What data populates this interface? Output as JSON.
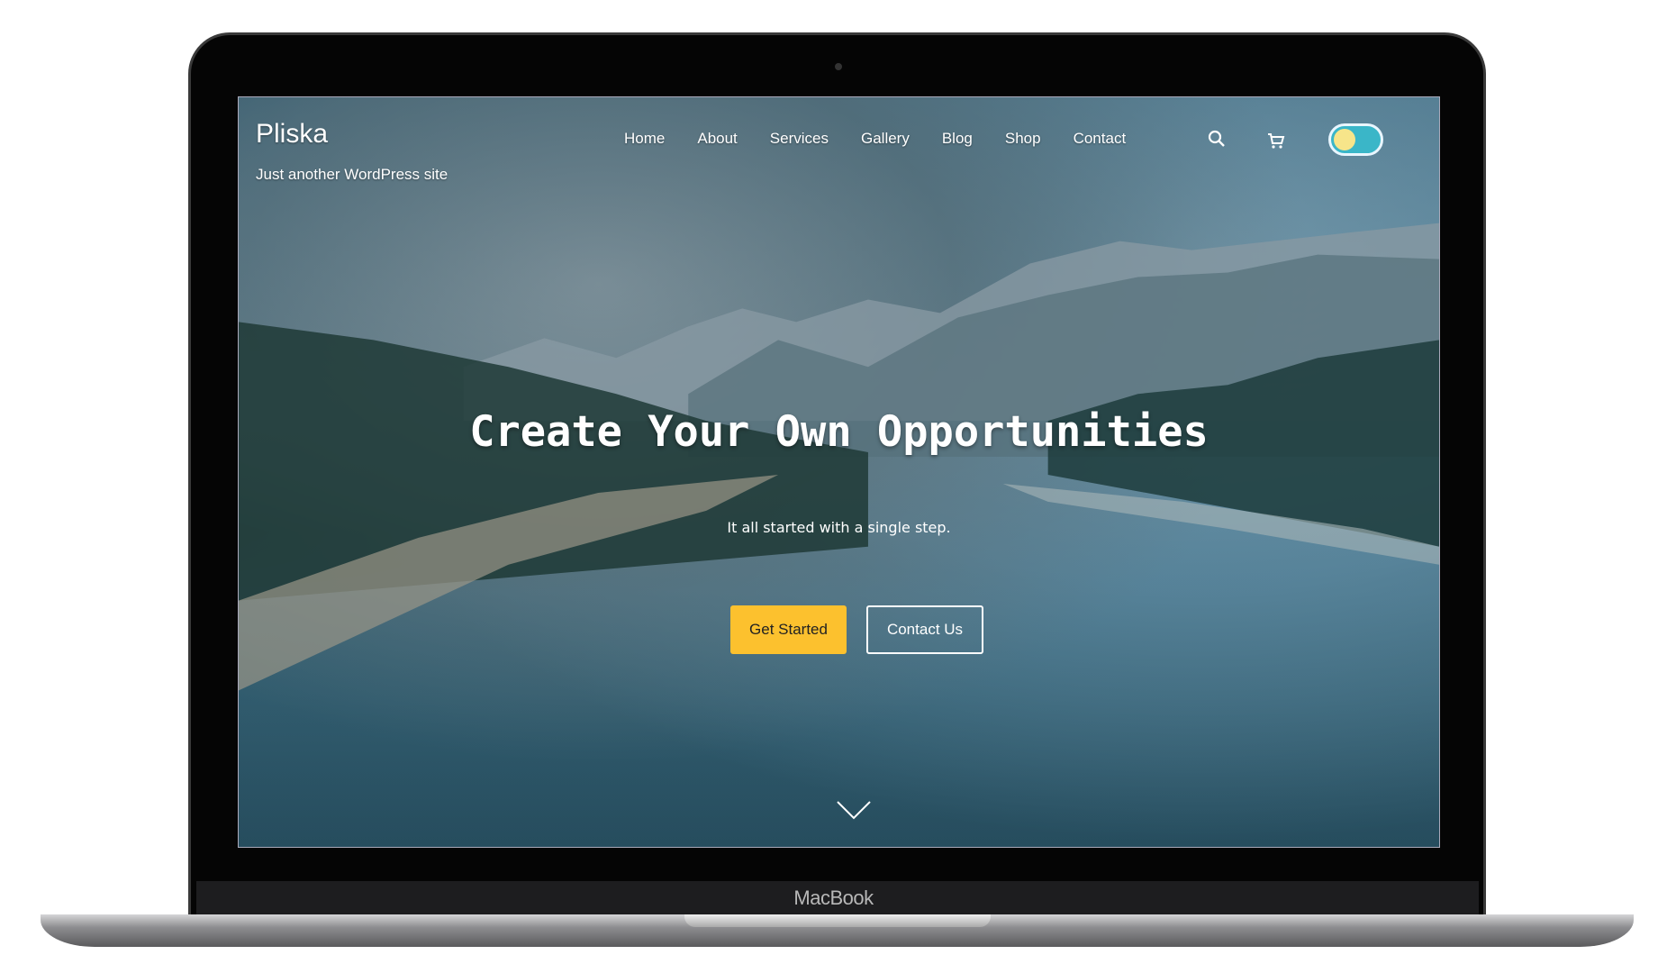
{
  "device": {
    "brand": "MacBook"
  },
  "site": {
    "title": "Pliska",
    "tagline": "Just another WordPress site"
  },
  "nav": {
    "items": [
      "Home",
      "About",
      "Services",
      "Gallery",
      "Blog",
      "Shop",
      "Contact"
    ],
    "icons": [
      "search-icon",
      "cart-icon"
    ],
    "theme_toggle": "light-mode"
  },
  "hero": {
    "title": "Create Your Own Opportunities",
    "subtitle": "It all started with a single step.",
    "primary_button": "Get Started",
    "secondary_button": "Contact Us",
    "scroll_icon": "chevron-down-icon"
  },
  "colors": {
    "accent": "#fcc12e",
    "toggle": "#3ab6c8"
  }
}
